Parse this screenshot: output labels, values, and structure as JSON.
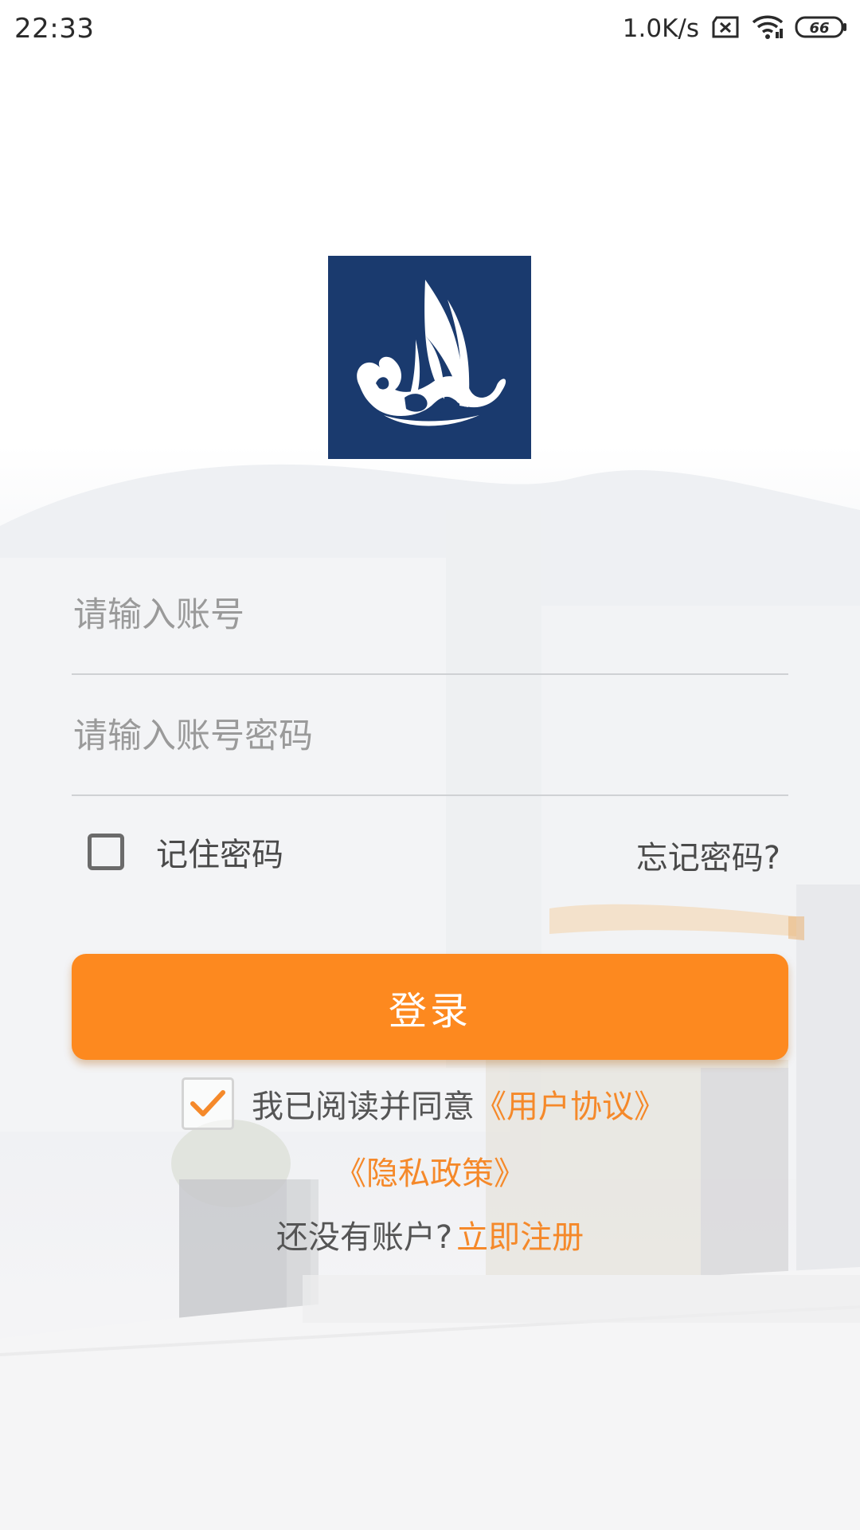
{
  "status_bar": {
    "time": "22:33",
    "net_speed": "1.0K/s",
    "battery": "66",
    "icons": [
      "sim-x-icon",
      "wifi-icon",
      "battery-icon"
    ]
  },
  "logo": {
    "icon": "sailboat-logo-icon"
  },
  "form": {
    "account_placeholder": "请输入账号",
    "password_placeholder": "请输入账号密码",
    "remember_label": "记住密码",
    "remember_checked": false,
    "forgot_label": "忘记密码?"
  },
  "login_button": {
    "label": "登录"
  },
  "agreement": {
    "checked": true,
    "prefix": "我已阅读并同意",
    "user_agreement": "《用户协议》",
    "privacy_policy": "《隐私政策》"
  },
  "register": {
    "prompt": "还没有账户?",
    "link": "立即注册"
  },
  "colors": {
    "accent": "#fd891f",
    "link": "#f5892a",
    "logo_bg": "#1a3a6e"
  }
}
